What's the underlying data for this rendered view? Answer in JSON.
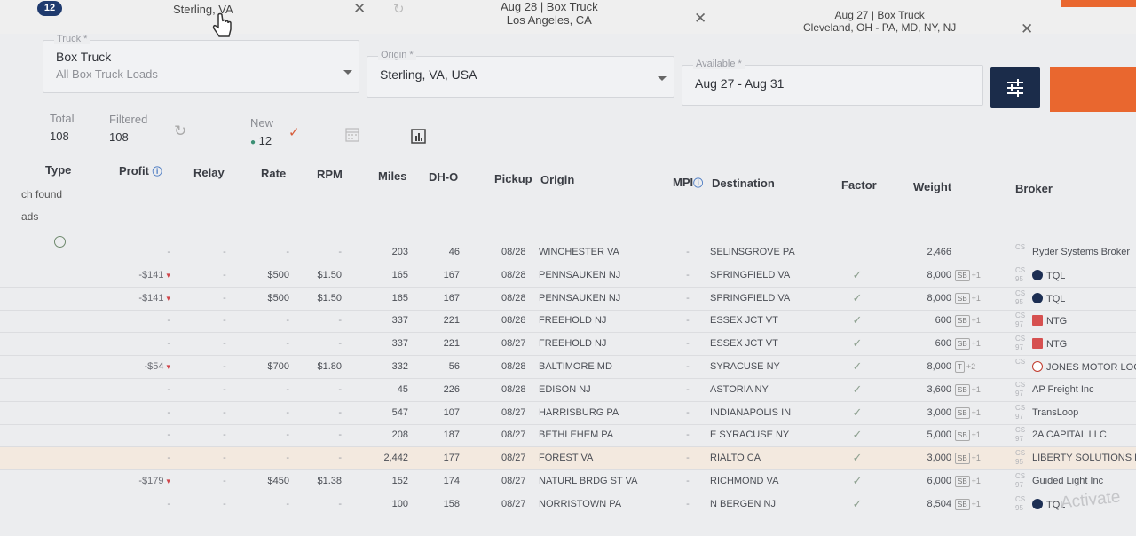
{
  "tabs": {
    "badge": "12",
    "tab1": "Sterling, VA",
    "tab2": {
      "line1": "Aug 28 | Box Truck",
      "line2": "Los Angeles, CA"
    },
    "tab3": {
      "line1": "Aug 27 | Box Truck",
      "line2": "Cleveland, OH - PA, MD, NY, NJ"
    }
  },
  "filters": {
    "truck_label": "Truck *",
    "truck_value": "Box Truck",
    "truck_sub": "All Box Truck Loads",
    "origin_label": "Origin *",
    "origin_value": "Sterling, VA, USA",
    "available_label": "Available *",
    "available_value": "Aug 27 - Aug 31"
  },
  "stats": {
    "total_label": "Total",
    "total_value": "108",
    "filtered_label": "Filtered",
    "filtered_value": "108",
    "new_label": "New",
    "new_value": "12"
  },
  "columns": [
    "Type",
    "Profit",
    "Relay",
    "Rate",
    "RPM",
    "Miles",
    "DH-O",
    "Pickup",
    "Origin",
    "MPI",
    "Destination",
    "Factor",
    "Weight",
    "Broker"
  ],
  "side_notes": [
    "ch found",
    "ads"
  ],
  "rows": [
    {
      "profit": "-",
      "relay": "-",
      "rate": "-",
      "rpm": "-",
      "miles": "203",
      "dho": "46",
      "pickup": "08/28",
      "origin": "WINCHESTER VA",
      "mpi": "-",
      "dest": "SELINSGROVE PA",
      "factor": "",
      "weight": "2,466",
      "tag": "",
      "plus": "",
      "cs1": "CS",
      "cs2": "",
      "broker": "Ryder Systems Broker",
      "bicon": ""
    },
    {
      "profit": "-$141",
      "relay": "-",
      "rate": "$500",
      "rpm": "$1.50",
      "miles": "165",
      "dho": "167",
      "pickup": "08/28",
      "origin": "PENNSAUKEN NJ",
      "mpi": "-",
      "dest": "SPRINGFIELD VA",
      "factor": "✓",
      "weight": "8,000",
      "tag": "SB",
      "plus": "+1",
      "cs1": "CS",
      "cs2": "95",
      "broker": "TQL",
      "bicon": "dot"
    },
    {
      "profit": "-$141",
      "relay": "-",
      "rate": "$500",
      "rpm": "$1.50",
      "miles": "165",
      "dho": "167",
      "pickup": "08/28",
      "origin": "PENNSAUKEN NJ",
      "mpi": "-",
      "dest": "SPRINGFIELD VA",
      "factor": "✓",
      "weight": "8,000",
      "tag": "SB",
      "plus": "+1",
      "cs1": "CS",
      "cs2": "95",
      "broker": "TQL",
      "bicon": "dot"
    },
    {
      "profit": "-",
      "relay": "-",
      "rate": "-",
      "rpm": "-",
      "miles": "337",
      "dho": "221",
      "pickup": "08/28",
      "origin": "FREEHOLD NJ",
      "mpi": "-",
      "dest": "ESSEX JCT VT",
      "factor": "✓",
      "weight": "600",
      "tag": "SB",
      "plus": "+1",
      "cs1": "CS",
      "cs2": "97",
      "broker": "NTG",
      "bicon": "red"
    },
    {
      "profit": "-",
      "relay": "-",
      "rate": "-",
      "rpm": "-",
      "miles": "337",
      "dho": "221",
      "pickup": "08/27",
      "origin": "FREEHOLD NJ",
      "mpi": "-",
      "dest": "ESSEX JCT VT",
      "factor": "✓",
      "weight": "600",
      "tag": "SB",
      "plus": "+1",
      "cs1": "CS",
      "cs2": "97",
      "broker": "NTG",
      "bicon": "red"
    },
    {
      "profit": "-$54",
      "relay": "-",
      "rate": "$700",
      "rpm": "$1.80",
      "miles": "332",
      "dho": "56",
      "pickup": "08/28",
      "origin": "BALTIMORE MD",
      "mpi": "-",
      "dest": "SYRACUSE NY",
      "factor": "✓",
      "weight": "8,000",
      "tag": "T",
      "plus": "+2",
      "cs1": "CS",
      "cs2": "",
      "broker": "JONES MOTOR LOG",
      "bicon": "warn"
    },
    {
      "profit": "-",
      "relay": "-",
      "rate": "-",
      "rpm": "-",
      "miles": "45",
      "dho": "226",
      "pickup": "08/28",
      "origin": "EDISON NJ",
      "mpi": "-",
      "dest": "ASTORIA NY",
      "factor": "✓",
      "weight": "3,600",
      "tag": "SB",
      "plus": "+1",
      "cs1": "CS",
      "cs2": "97",
      "broker": "AP Freight Inc",
      "bicon": ""
    },
    {
      "profit": "-",
      "relay": "-",
      "rate": "-",
      "rpm": "-",
      "miles": "547",
      "dho": "107",
      "pickup": "08/27",
      "origin": "HARRISBURG PA",
      "mpi": "-",
      "dest": "INDIANAPOLIS IN",
      "factor": "✓",
      "weight": "3,000",
      "tag": "SB",
      "plus": "+1",
      "cs1": "CS",
      "cs2": "97",
      "broker": "TransLoop",
      "bicon": ""
    },
    {
      "profit": "-",
      "relay": "-",
      "rate": "-",
      "rpm": "-",
      "miles": "208",
      "dho": "187",
      "pickup": "08/27",
      "origin": "BETHLEHEM PA",
      "mpi": "-",
      "dest": "E SYRACUSE NY",
      "factor": "✓",
      "weight": "5,000",
      "tag": "SB",
      "plus": "+1",
      "cs1": "CS",
      "cs2": "97",
      "broker": "2A CAPITAL LLC",
      "bicon": ""
    },
    {
      "profit": "-",
      "relay": "-",
      "rate": "-",
      "rpm": "-",
      "miles": "2,442",
      "dho": "177",
      "pickup": "08/27",
      "origin": "FOREST VA",
      "mpi": "-",
      "dest": "RIALTO CA",
      "factor": "✓",
      "weight": "3,000",
      "tag": "SB",
      "plus": "+1",
      "cs1": "CS",
      "cs2": "95",
      "broker": "LIBERTY SOLUTIONS LOG",
      "bicon": ""
    },
    {
      "profit": "-$179",
      "relay": "-",
      "rate": "$450",
      "rpm": "$1.38",
      "miles": "152",
      "dho": "174",
      "pickup": "08/27",
      "origin": "NATURL BRDG ST VA",
      "mpi": "-",
      "dest": "RICHMOND VA",
      "factor": "✓",
      "weight": "6,000",
      "tag": "SB",
      "plus": "+1",
      "cs1": "CS",
      "cs2": "97",
      "broker": "Guided Light Inc",
      "bicon": ""
    },
    {
      "profit": "-",
      "relay": "-",
      "rate": "-",
      "rpm": "-",
      "miles": "100",
      "dho": "158",
      "pickup": "08/27",
      "origin": "NORRISTOWN PA",
      "mpi": "-",
      "dest": "N BERGEN NJ",
      "factor": "✓",
      "weight": "8,504",
      "tag": "SB",
      "plus": "+1",
      "cs1": "CS",
      "cs2": "95",
      "broker": "TQL",
      "bicon": "dot"
    }
  ],
  "watermark": "Activate"
}
